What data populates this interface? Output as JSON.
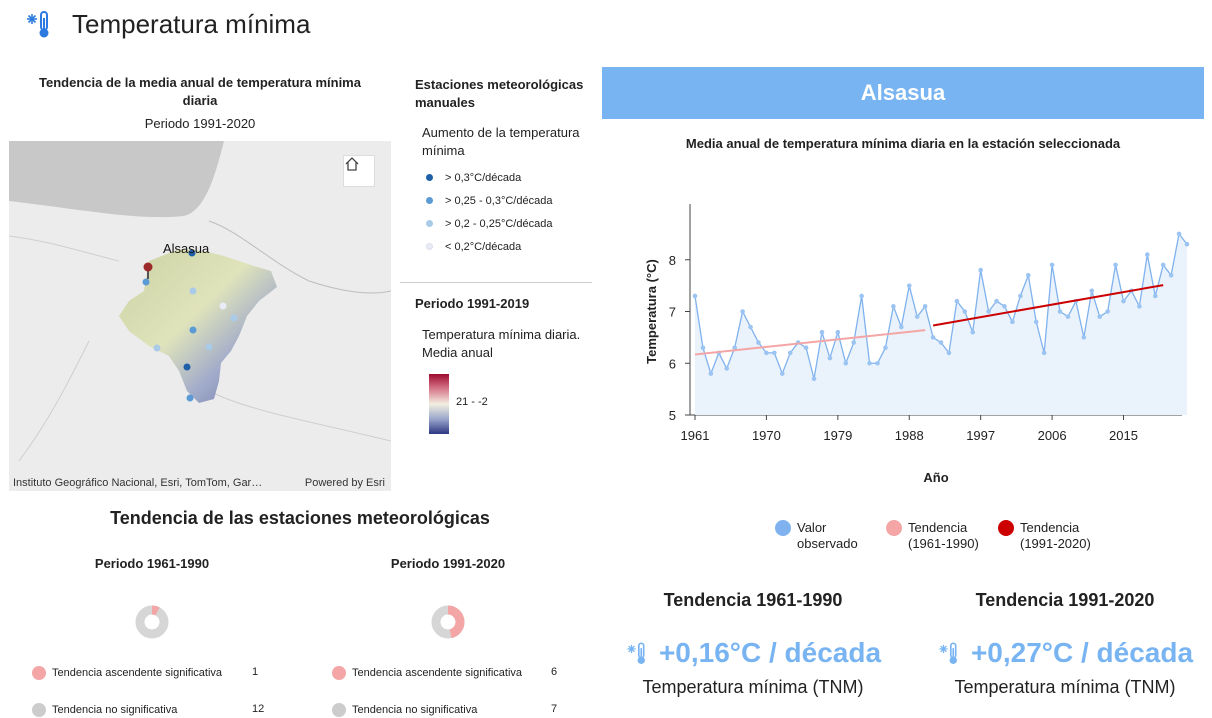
{
  "header": {
    "title": "Temperatura mínima",
    "icon": "thermometer-cold-icon"
  },
  "map_panel": {
    "title": "Tendencia de la media anual de temperatura mínima diaria",
    "period": "Periodo 1991-2020",
    "station_label": "Alsasua",
    "attribution": "Instituto Geográfico Nacional, Esri, TomTom, Gar…",
    "powered_by": "Powered by Esri",
    "home_icon": "home-icon"
  },
  "map_legend": {
    "heading": "Estaciones meteorológicas manuales",
    "sub": "Aumento de la temperatura mínima",
    "items": [
      {
        "label": "> 0,3°C/década",
        "color": "#1f5fa8"
      },
      {
        "label": "> 0,25 - 0,3°C/década",
        "color": "#5b9bd5"
      },
      {
        "label": "> 0,2 - 0,25°C/década",
        "color": "#a9cbe8"
      },
      {
        "label": "< 0,2°C/década",
        "color": "#e9ecf6"
      }
    ],
    "heading2": "Periodo 1991-2019",
    "sub2": "Temperatura mínima diaria. Media anual",
    "ramp_label": "21 - -2"
  },
  "stations_trend": {
    "title": "Tendencia de las estaciones meteorológicas",
    "periods": [
      {
        "label": "Periodo 1961-1990",
        "rows": [
          {
            "label": "Tendencia ascendente significativa",
            "count": "1",
            "color": "#f4a6a6"
          },
          {
            "label": "Tendencia no significativa",
            "count": "12",
            "color": "#cccccc"
          }
        ]
      },
      {
        "label": "Periodo 1991-2020",
        "rows": [
          {
            "label": "Tendencia ascendente significativa",
            "count": "6",
            "color": "#f4a6a6"
          },
          {
            "label": "Tendencia no significativa",
            "count": "7",
            "color": "#cccccc"
          }
        ]
      }
    ]
  },
  "station": {
    "name": "Alsasua"
  },
  "chart_title": "Media anual de temperatura mínima diaria en la estación seleccionada",
  "chart_data": {
    "type": "line",
    "title": "Media anual de temperatura mínima diaria en la estación seleccionada",
    "xlabel": "Año",
    "ylabel": "Temperatura (°C)",
    "xlim": [
      1961,
      2023
    ],
    "ylim": [
      5,
      9
    ],
    "xticks": [
      1961,
      1970,
      1979,
      1988,
      1997,
      2006,
      2015
    ],
    "yticks": [
      5,
      6,
      7,
      8
    ],
    "area_fill": true,
    "series": [
      {
        "name": "Valor observado",
        "color": "#7fb2ee",
        "x": [
          1961,
          1962,
          1963,
          1964,
          1965,
          1966,
          1967,
          1968,
          1969,
          1970,
          1971,
          1972,
          1973,
          1974,
          1975,
          1976,
          1977,
          1978,
          1979,
          1980,
          1981,
          1982,
          1983,
          1984,
          1985,
          1986,
          1987,
          1988,
          1989,
          1990,
          1991,
          1992,
          1993,
          1994,
          1995,
          1996,
          1997,
          1998,
          1999,
          2000,
          2001,
          2002,
          2003,
          2004,
          2005,
          2006,
          2007,
          2008,
          2009,
          2010,
          2011,
          2012,
          2013,
          2014,
          2015,
          2016,
          2017,
          2018,
          2019,
          2020,
          2021,
          2022,
          2023
        ],
        "y": [
          7.3,
          6.3,
          5.8,
          6.2,
          5.9,
          6.3,
          7.0,
          6.7,
          6.4,
          6.2,
          6.2,
          5.8,
          6.2,
          6.4,
          6.3,
          5.7,
          6.6,
          6.1,
          6.6,
          6.0,
          6.4,
          7.3,
          6.0,
          6.0,
          6.3,
          7.1,
          6.7,
          7.5,
          6.9,
          7.1,
          6.5,
          6.4,
          6.2,
          7.2,
          7.0,
          6.6,
          7.8,
          7.0,
          7.2,
          7.1,
          6.8,
          7.3,
          7.7,
          6.8,
          6.2,
          7.9,
          7.0,
          6.9,
          7.2,
          6.5,
          7.4,
          6.9,
          7.0,
          7.9,
          7.2,
          7.4,
          7.1,
          8.1,
          7.3,
          7.9,
          7.7,
          8.5,
          8.3
        ]
      },
      {
        "name": "Tendencia (1961-1990)",
        "color": "#f4a6a6",
        "x": [
          1961,
          1990
        ],
        "y": [
          6.17,
          6.64
        ]
      },
      {
        "name": "Tendencia (1991-2020)",
        "color": "#cc0000",
        "x": [
          1991,
          2020
        ],
        "y": [
          6.73,
          7.51
        ]
      }
    ]
  },
  "chart_legend": [
    {
      "label": "Valor observado",
      "color": "#7fb2ee"
    },
    {
      "label": "Tendencia (1961-1990)",
      "color": "#f4a6a6"
    },
    {
      "label": "Tendencia (1991-2020)",
      "color": "#cc0000"
    }
  ],
  "kpis": [
    {
      "title": "Tendencia 1961-1990",
      "value": "+0,16°C / década",
      "subtitle": "Temperatura mínima (TNM)",
      "icon": "thermometer-cold-icon"
    },
    {
      "title": "Tendencia 1991-2020",
      "value": "+0,27°C / década",
      "subtitle": "Temperatura mínima (TNM)",
      "icon": "thermometer-cold-icon"
    }
  ]
}
